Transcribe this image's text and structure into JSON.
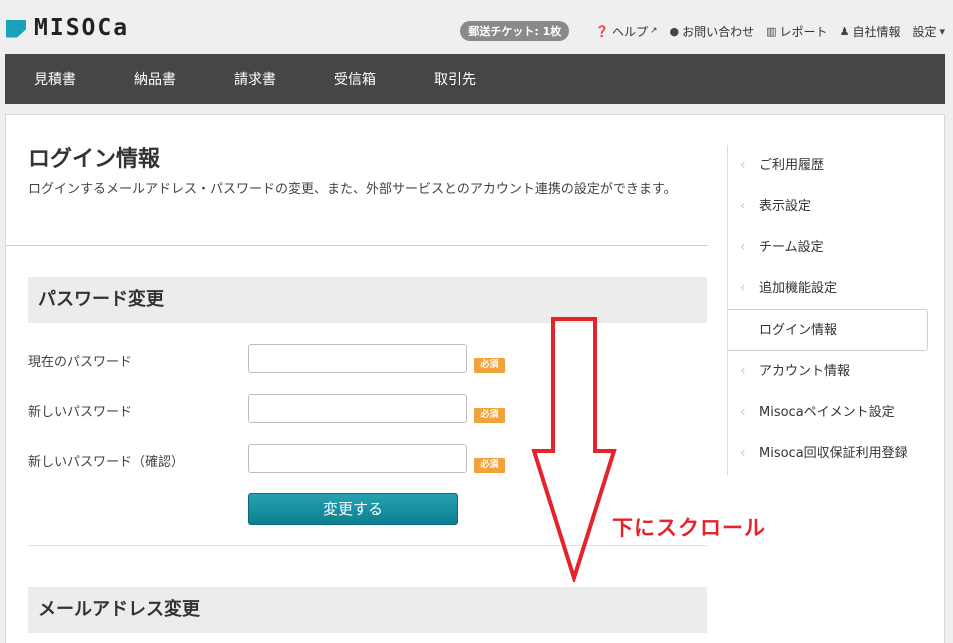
{
  "header": {
    "logo_text": "MISOCa",
    "ticket": "郵送チケット: 1枚",
    "links": [
      {
        "icon": "question-circle-icon",
        "label": "ヘルプ",
        "external": true
      },
      {
        "icon": "chat-bubble-icon",
        "label": "お問い合わせ"
      },
      {
        "icon": "bar-chart-icon",
        "label": "レポート"
      },
      {
        "icon": "user-icon",
        "label": "自社情報"
      },
      {
        "icon": "caret-down-icon",
        "label": "設定"
      }
    ]
  },
  "nav": {
    "items": [
      "見積書",
      "納品書",
      "請求書",
      "受信箱",
      "取引先"
    ]
  },
  "page": {
    "title": "ログイン情報",
    "description": "ログインするメールアドレス・パスワードの変更、また、外部サービスとのアカウント連携の設定ができます。"
  },
  "password_section": {
    "title": "パスワード変更",
    "fields": [
      {
        "label": "現在のパスワード",
        "required": "必須",
        "value": ""
      },
      {
        "label": "新しいパスワード",
        "required": "必須",
        "value": ""
      },
      {
        "label": "新しいパスワード（確認）",
        "required": "必須",
        "value": ""
      }
    ],
    "submit_label": "変更する"
  },
  "email_section": {
    "title": "メールアドレス変更"
  },
  "sidebar": {
    "items": [
      {
        "label": "ご利用履歴",
        "active": false
      },
      {
        "label": "表示設定",
        "active": false
      },
      {
        "label": "チーム設定",
        "active": false
      },
      {
        "label": "追加機能設定",
        "active": false
      },
      {
        "label": "ログイン情報",
        "active": true
      },
      {
        "label": "アカウント情報",
        "active": false
      },
      {
        "label": "Misocaペイメント設定",
        "active": false
      },
      {
        "label": "Misoca回収保証利用登録",
        "active": false
      }
    ]
  },
  "annotation": {
    "text": "下にスクロール",
    "color": "#e4232a"
  },
  "colors": {
    "accent": "#1aa3b8",
    "nav_bg": "#464646",
    "button": "#128a9a",
    "required": "#f2a23a"
  }
}
